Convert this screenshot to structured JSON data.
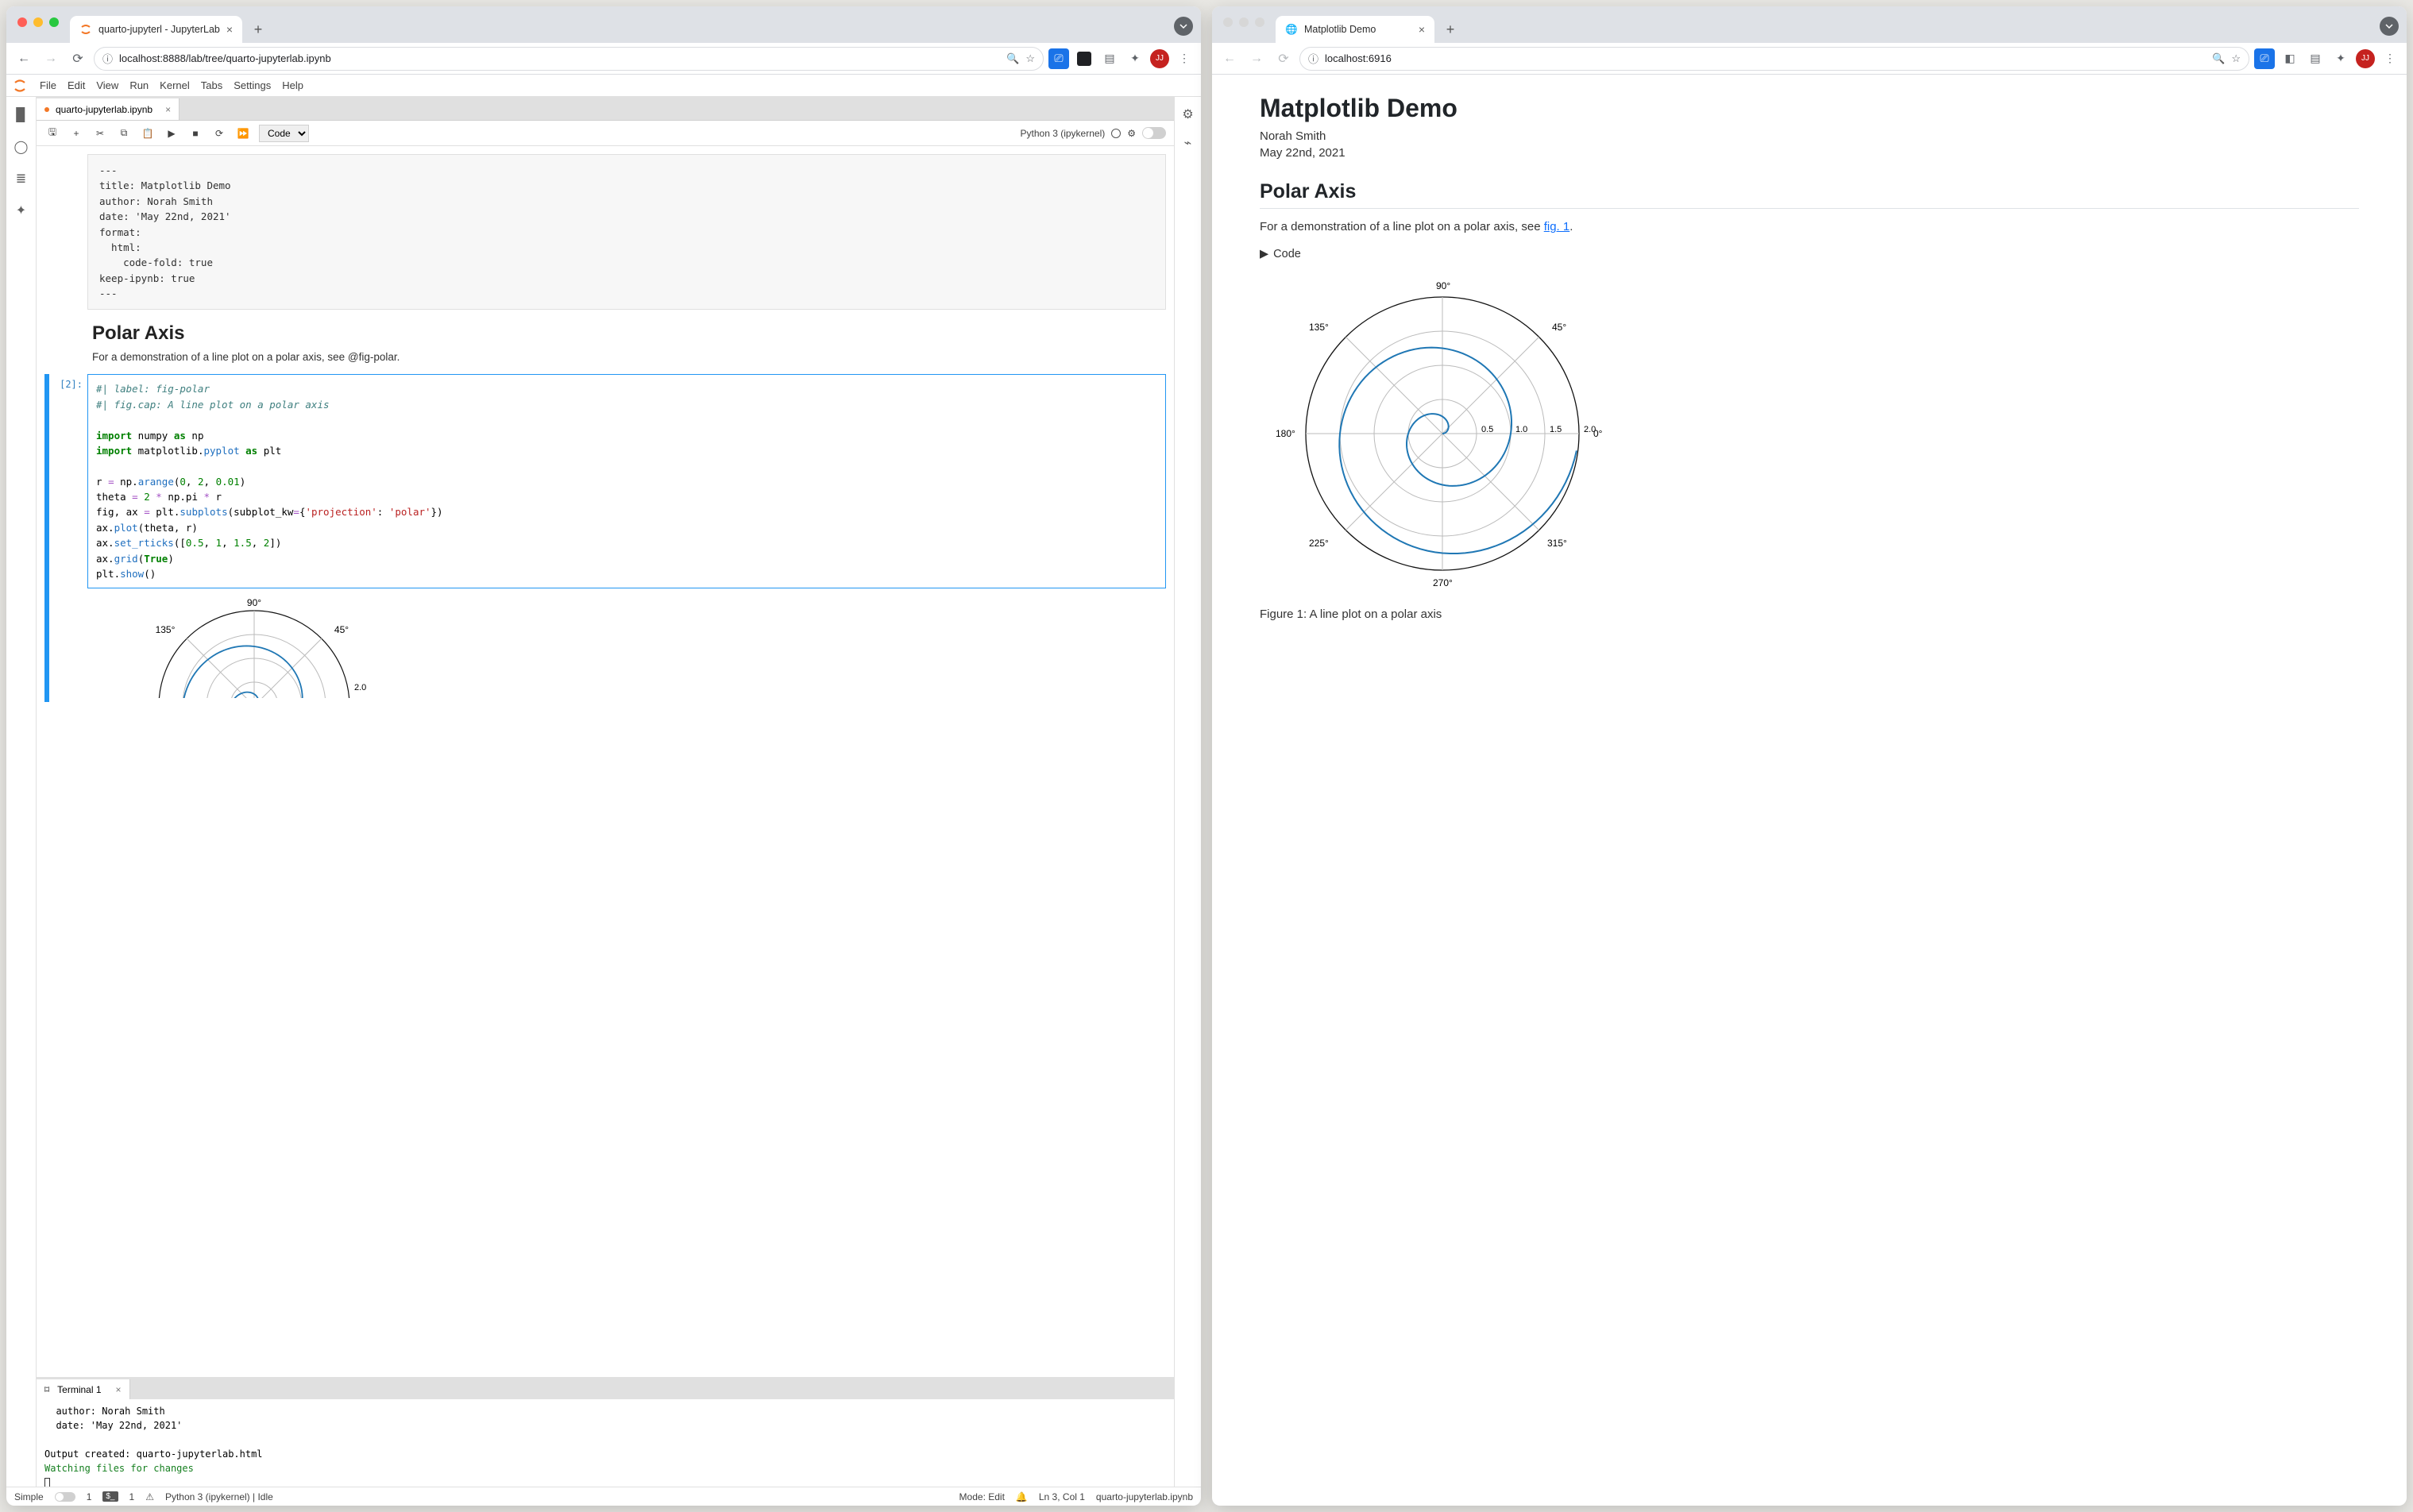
{
  "left_window": {
    "tab_title": "quarto-jupyterl - JupyterLab",
    "url": "localhost:8888/lab/tree/quarto-jupyterlab.ipynb",
    "avatar": "JJ",
    "menubar": [
      "File",
      "Edit",
      "View",
      "Run",
      "Kernel",
      "Tabs",
      "Settings",
      "Help"
    ],
    "notebook_tab": "quarto-jupyterlab.ipynb",
    "toolbar": {
      "celltype": "Code",
      "kernel": "Python 3 (ipykernel)"
    },
    "raw_cell": "---\ntitle: Matplotlib Demo\nauthor: Norah Smith\ndate: 'May 22nd, 2021'\nformat:\n  html:\n    code-fold: true\nkeep-ipynb: true\n---",
    "md_heading": "Polar Axis",
    "md_para": "For a demonstration of a line plot on a polar axis, see @fig-polar.",
    "code_prompt": "[2]:",
    "terminal_tab": "Terminal 1",
    "terminal_body": "  author: Norah Smith\n  date: 'May 22nd, 2021'\n\nOutput created: quarto-jupyterlab.html\n",
    "terminal_watch": "Watching files for changes",
    "status": {
      "simple": "Simple",
      "one": "1",
      "kernel": "Python 3 (ipykernel) | Idle",
      "mode": "Mode: Edit",
      "ln": "Ln 3, Col 1",
      "path": "quarto-jupyterlab.ipynb"
    },
    "polar_plot": {
      "angles": [
        "90°",
        "135°",
        "45°"
      ],
      "rad_tick": "2.0"
    }
  },
  "right_window": {
    "tab_title": "Matplotlib Demo",
    "url": "localhost:6916",
    "avatar": "JJ",
    "title": "Matplotlib Demo",
    "author": "Norah Smith",
    "date": "May 22nd, 2021",
    "h2": "Polar Axis",
    "para_pre": "For a demonstration of a line plot on a polar axis, see ",
    "para_link": "fig. 1",
    "para_post": ".",
    "codefold": "Code",
    "caption": "Figure 1: A line plot on a polar axis",
    "polar": {
      "angles": [
        "0°",
        "45°",
        "90°",
        "135°",
        "180°",
        "225°",
        "270°",
        "315°"
      ],
      "rticks": [
        "0.5",
        "1.0",
        "1.5",
        "2.0"
      ]
    }
  },
  "chart_data": {
    "type": "line",
    "title": "A line plot on a polar axis",
    "projection": "polar",
    "theta_labels_deg": [
      0,
      45,
      90,
      135,
      180,
      225,
      270,
      315
    ],
    "r_ticks": [
      0.5,
      1.0,
      1.5,
      2.0
    ],
    "r_range": [
      0,
      2
    ],
    "series": [
      {
        "name": "spiral",
        "theta_formula": "2*pi*r",
        "r": [
          0,
          0.1,
          0.2,
          0.3,
          0.4,
          0.5,
          0.6,
          0.7,
          0.8,
          0.9,
          1.0,
          1.1,
          1.2,
          1.3,
          1.4,
          1.5,
          1.6,
          1.7,
          1.8,
          1.9,
          1.99
        ]
      }
    ],
    "grid": true
  }
}
